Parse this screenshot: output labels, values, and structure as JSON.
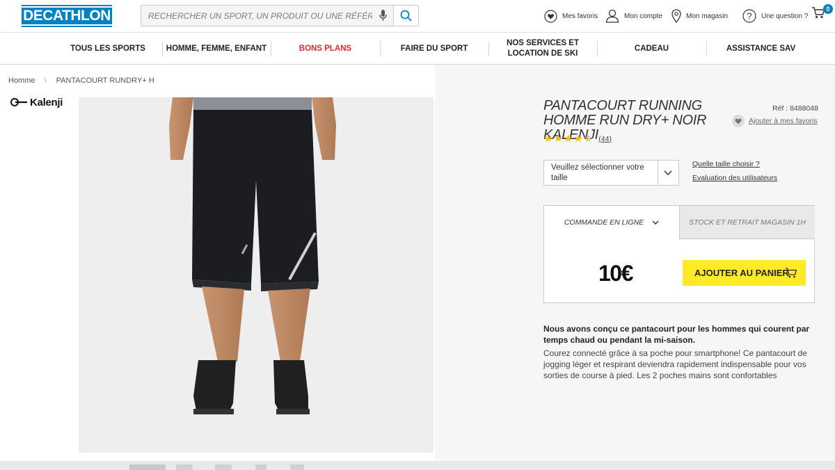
{
  "header": {
    "logo": "DECATHLON",
    "search_placeholder": "RECHERCHER UN SPORT, UN PRODUIT OU UNE RÉFÉRENCE",
    "favorites": "Mes favoris",
    "account": "Mon compte",
    "store": "Mon magasin",
    "question": "Une question ?",
    "cart_count": "0"
  },
  "nav": {
    "items": [
      {
        "label": "TOUS LES SPORTS"
      },
      {
        "label": "HOMME, FEMME, ENFANT"
      },
      {
        "label": "BONS PLANS",
        "color": "#e3262f"
      },
      {
        "label": "FAIRE DU SPORT"
      },
      {
        "label": "NOS SERVICES ET LOCATION DE SKI"
      },
      {
        "label": "CADEAU"
      },
      {
        "label": "ASSISTANCE SAV"
      }
    ]
  },
  "breadcrumb": {
    "home": "Homme",
    "current": "PANTACOURT RUNDRY+ H"
  },
  "brand": {
    "name": "Kalenji"
  },
  "product": {
    "title": "PANTACOURT RUNNING HOMME RUN DRY+ NOIR KALENJI",
    "ref": "Réf : 8488048",
    "add_favorite": "Ajouter à mes favoris",
    "rating_stars": 4.5,
    "rating_count": "(44)",
    "size_placeholder": "Veuillez sélectionner votre taille",
    "size_help": "Quelle taille choisir ?",
    "user_reviews": "Evaluation des utilisateurs",
    "tab_online": "COMMANDE EN LIGNE",
    "tab_store": "STOCK ET RETRAIT MAGASIN 1H",
    "price": "10€",
    "add_to_cart": "AJOUTER AU PANIER",
    "description_bold": "Nous avons conçu ce pantacourt pour les hommes qui courent par temps chaud ou pendant la mi-saison.",
    "description": "Courez connecté grâce à sa poche pour smartphone! Ce pantacourt de jogging léger et respirant deviendra rapidement indispensable pour vos sorties de course à pied. Les 2 poches mains sont confortables"
  },
  "colors": {
    "brand_blue": "#0082c3",
    "cta_yellow": "#ffea28",
    "sale_red": "#e3262f",
    "star_yellow": "#f2c200"
  }
}
